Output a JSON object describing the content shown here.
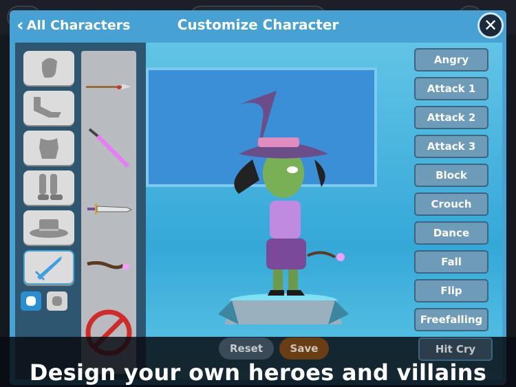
{
  "header": {
    "back_label": "All Characters",
    "title": "Customize Character"
  },
  "slots": [
    {
      "name": "head",
      "icon": "head-icon"
    },
    {
      "name": "arm",
      "icon": "arm-icon"
    },
    {
      "name": "torso",
      "icon": "torso-icon"
    },
    {
      "name": "legs",
      "icon": "boots-icon"
    },
    {
      "name": "hat",
      "icon": "hat-icon"
    },
    {
      "name": "weapon",
      "icon": "sword-icon",
      "selected": true
    }
  ],
  "items": [
    "spear",
    "pink-sword",
    "dagger",
    "magic-staff",
    "none"
  ],
  "animations": [
    "Angry",
    "Attack 1",
    "Attack 2",
    "Attack 3",
    "Block",
    "Crouch",
    "Dance",
    "Fall",
    "Flip",
    "Freefalling",
    "Hit Cry"
  ],
  "buttons": {
    "reset": "Reset",
    "save": "Save"
  },
  "caption": "Design your own heroes and villains",
  "colors": {
    "accent": "#47a1d3",
    "selected_hand": "#2a8fd0"
  }
}
